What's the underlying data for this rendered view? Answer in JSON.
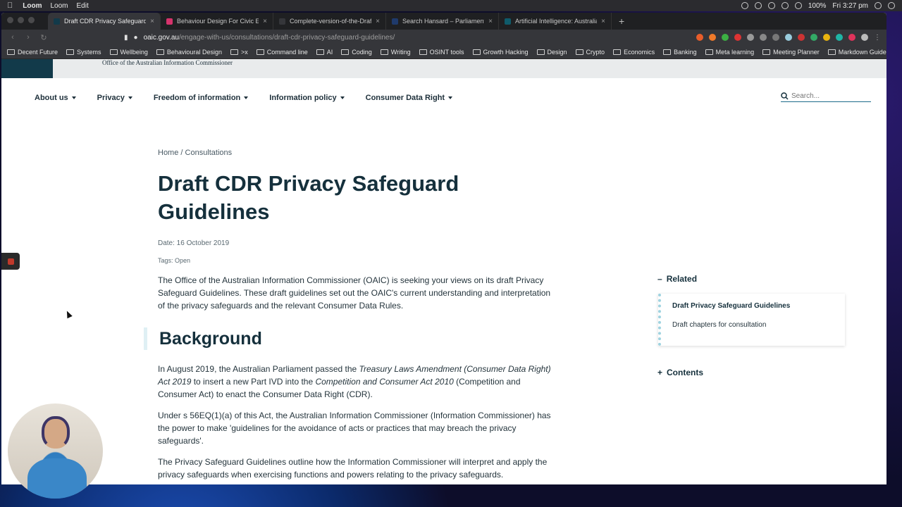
{
  "menubar": {
    "app_name": "Loom",
    "items": [
      "Loom",
      "Edit"
    ],
    "battery": "100%",
    "clock": "Fri 3:27 pm"
  },
  "browser": {
    "tabs": [
      {
        "title": "Draft CDR Privacy Safeguard Gu",
        "favicon_color": "#123a4a",
        "active": true
      },
      {
        "title": "Behaviour Design For Civic Engag",
        "favicon_color": "#d6336c",
        "active": false
      },
      {
        "title": "Complete-version-of-the-Draft-",
        "favicon_color": "#35363a",
        "active": false
      },
      {
        "title": "Search Hansard – Parliament of",
        "favicon_color": "#1f3a6b",
        "active": false
      },
      {
        "title": "Artificial Intelligence: Australia's",
        "favicon_color": "#0f5b6b",
        "active": false
      }
    ],
    "new_tab": "+",
    "url_host": "oaic.gov.au",
    "url_path": "/engage-with-us/consultations/draft-cdr-privacy-safeguard-guidelines/",
    "bookmarks": [
      "Decent Future",
      "Systems",
      "Wellbeing",
      "Behavioural Design",
      ">x",
      "Command line",
      "AI",
      "Coding",
      "Writing",
      "OSINT tools",
      "Growth Hacking",
      "Design",
      "Crypto",
      "Economics",
      "Banking",
      "Meta learning",
      "Meeting Planner",
      "Markdown Guide"
    ],
    "bookmarks_more": "»"
  },
  "site": {
    "org_name": "Office of the Australian Information Commissioner",
    "nav": [
      "About us",
      "Privacy",
      "Freedom of information",
      "Information policy",
      "Consumer Data Right"
    ],
    "search_placeholder": "Search..."
  },
  "article": {
    "breadcrumb": "Home / Consultations",
    "title": "Draft CDR Privacy Safeguard Guidelines",
    "date": "Date: 16 October 2019",
    "tags": "Tags: Open",
    "intro": "The Office of the Australian Information Commissioner (OAIC) is seeking your views on its draft Privacy Safeguard Guidelines. These draft guidelines set out the OAIC's current understanding and interpretation of the privacy safeguards and the relevant Consumer Data Rules.",
    "background_heading": "Background",
    "p1_a": "In August 2019, the Australian Parliament passed the ",
    "p1_b": "Treasury Laws Amendment (Consumer Data Right) Act 2019",
    "p1_c": " to insert a new Part IVD into the ",
    "p1_d": "Competition and Consumer Act 2010",
    "p1_e": " (Competition and Consumer Act) to enact the Consumer Data Right (CDR).",
    "p2": "Under s 56EQ(1)(a) of this Act, the Australian Information Commissioner (Information Commissioner) has the power to make 'guidelines for the avoidance of acts or practices that may breach the privacy safeguards'.",
    "p3": "The Privacy Safeguard Guidelines outline how the Information Commissioner will interpret and apply the privacy safeguards when exercising functions and powers relating to the privacy safeguards."
  },
  "sidebar": {
    "related_toggle": "–",
    "related_heading": "Related",
    "related_link_1": "Draft Privacy Safeguard Guidelines",
    "related_link_2": "Draft chapters for consultation",
    "contents_toggle": "+",
    "contents_heading": "Contents"
  }
}
